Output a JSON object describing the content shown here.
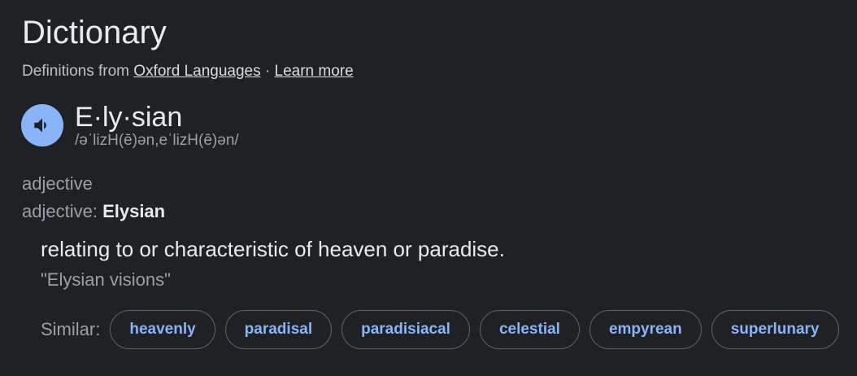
{
  "header": {
    "title": "Dictionary",
    "source_prefix": "Definitions from ",
    "source_link": "Oxford Languages",
    "separator": " · ",
    "learn_more": "Learn more"
  },
  "entry": {
    "audio_icon": "speaker-icon",
    "word": "E·ly·sian",
    "phonetic": "/əˈlizH(ē)ən,eˈlizH(ē)ən/",
    "part_of_speech": "adjective",
    "pos_label": "adjective: ",
    "pos_value": "Elysian",
    "definition": "relating to or characteristic of heaven or paradise.",
    "example": "\"Elysian visions\""
  },
  "similar": {
    "label": "Similar:",
    "words": [
      "heavenly",
      "paradisal",
      "paradisiacal",
      "celestial",
      "empyrean",
      "superlunary"
    ]
  },
  "colors": {
    "background": "#202124",
    "accent": "#8ab4f8",
    "text": "#e8eaed",
    "muted": "#9aa0a6"
  }
}
